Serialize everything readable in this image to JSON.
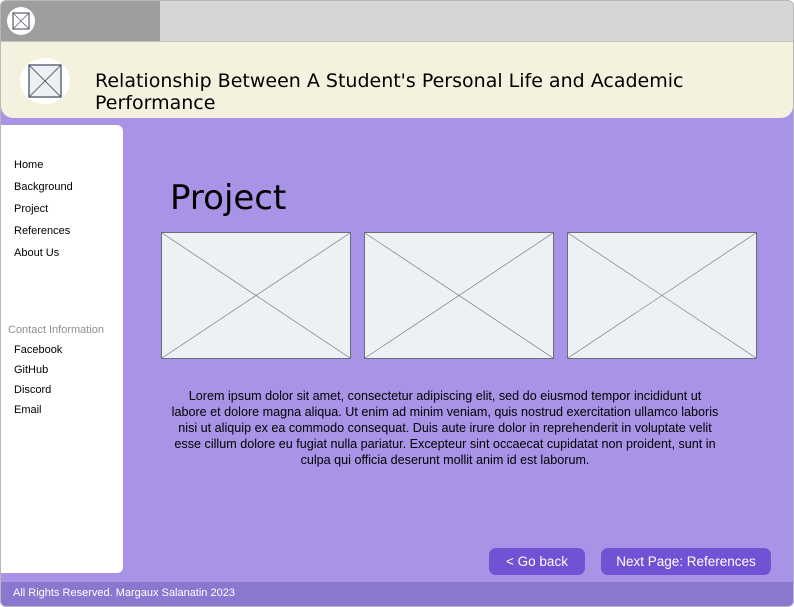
{
  "header": {
    "title": "Relationship Between A Student's Personal Life and Academic Performance"
  },
  "sidebar": {
    "nav_items": [
      {
        "label": "Home"
      },
      {
        "label": "Background"
      },
      {
        "label": "Project"
      },
      {
        "label": "References"
      },
      {
        "label": "About Us"
      }
    ],
    "contact_heading": "Contact Information",
    "contact_items": [
      {
        "label": "Facebook"
      },
      {
        "label": "GitHub"
      },
      {
        "label": "Discord"
      },
      {
        "label": "Email"
      }
    ]
  },
  "main": {
    "heading": "Project",
    "images": [
      {
        "icon": "image-placeholder-icon"
      },
      {
        "icon": "image-placeholder-icon"
      },
      {
        "icon": "image-placeholder-icon"
      }
    ],
    "body_text": "Lorem ipsum dolor sit amet, consectetur adipiscing elit, sed do eiusmod tempor incididunt ut labore et dolore magna aliqua. Ut enim ad minim veniam, quis nostrud exercitation ullamco laboris nisi ut aliquip ex ea commodo consequat. Duis aute irure dolor in reprehenderit in voluptate velit esse cillum dolore eu fugiat nulla pariatur. Excepteur sint occaecat cupidatat non proident, sunt in culpa qui officia deserunt mollit anim id est laborum."
  },
  "buttons": {
    "back_label": "< Go back",
    "next_label": "Next Page: References"
  },
  "footer": {
    "text": "All Rights Reserved. Margaux Salanatin 2023"
  },
  "colors": {
    "content_background": "#a993e6",
    "header_background": "#f4f2de",
    "button": "#7151d4",
    "footer": "#8b77cf"
  }
}
